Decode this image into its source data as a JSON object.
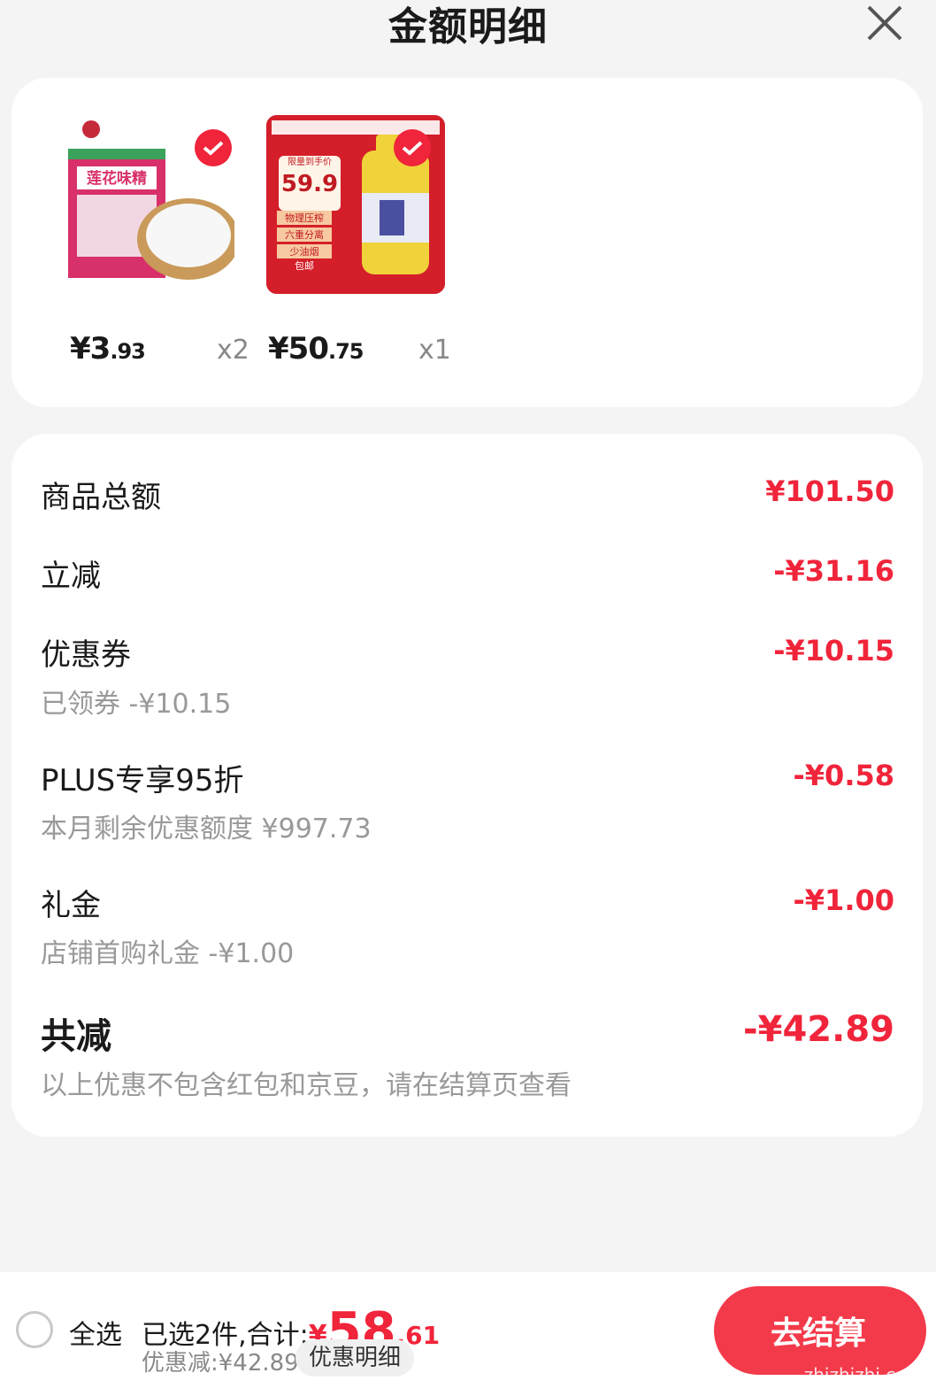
{
  "header": {
    "title": "金额明细",
    "close_icon": "close-icon"
  },
  "products": [
    {
      "label": "莲花味精",
      "price_int": "¥3",
      "price_dec": ".93",
      "qty": "x2",
      "checked": true
    },
    {
      "badge": "限量到手价",
      "promo_price": "59.9",
      "tags": [
        "物理压榨",
        "六重分离",
        "少油烟",
        "包邮"
      ],
      "price_int": "¥50",
      "price_dec": ".75",
      "qty": "x1",
      "checked": true
    }
  ],
  "details": {
    "subtotal": {
      "label": "商品总额",
      "value": "¥101.50"
    },
    "instant": {
      "label": "立减",
      "value": "-¥31.16"
    },
    "coupon": {
      "label": "优惠券",
      "value": "-¥10.15",
      "sub": "已领券 -¥10.15"
    },
    "plus": {
      "label": "PLUS专享95折",
      "value": "-¥0.58",
      "sub": "本月剩余优惠额度 ¥997.73"
    },
    "gift": {
      "label": "礼金",
      "value": "-¥1.00",
      "sub": "店铺首购礼金 -¥1.00"
    },
    "total": {
      "label": "共减",
      "value": "-¥42.89",
      "sub": "以上优惠不包含红包和京豆，请在结算页查看"
    }
  },
  "bottom": {
    "select_all": "全选",
    "selected_text": "已选2件,合计:",
    "yen": "¥",
    "total_int": "58",
    "total_dec": ".61",
    "discount_text": "优惠减:¥42.89",
    "discount_detail_button": "优惠明细",
    "checkout_button": "去结算",
    "watermark": "zhizhizhi.com"
  },
  "colors": {
    "accent": "#f0243a",
    "background": "#f4f4f4"
  }
}
